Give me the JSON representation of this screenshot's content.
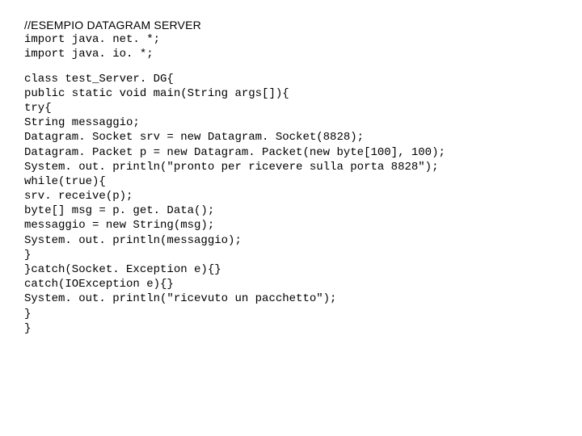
{
  "heading": "//ESEMPIO DATAGRAM SERVER",
  "code_lines": [
    "import java. net. *;",
    "import java. io. *;",
    "",
    "class test_Server. DG{",
    "public static void main(String args[]){",
    "try{",
    "String messaggio;",
    "Datagram. Socket srv = new Datagram. Socket(8828);",
    "Datagram. Packet p = new Datagram. Packet(new byte[100], 100);",
    "System. out. println(\"pronto per ricevere sulla porta 8828\");",
    "while(true){",
    "srv. receive(p);",
    "byte[] msg = p. get. Data();",
    "messaggio = new String(msg);",
    "System. out. println(messaggio);",
    "}",
    "}catch(Socket. Exception e){}",
    "catch(IOException e){}",
    "System. out. println(\"ricevuto un pacchetto\");",
    "}",
    "}"
  ]
}
